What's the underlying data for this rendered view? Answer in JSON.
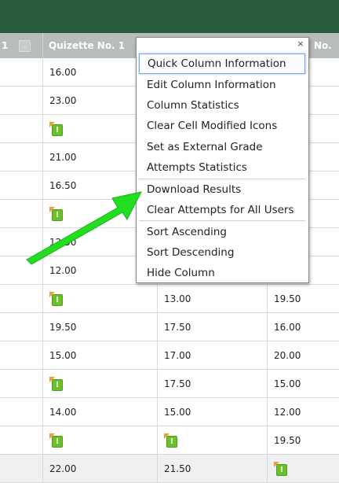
{
  "header": {
    "col0_label": "1",
    "col1_label": "Quizette No. 1",
    "col3_label": "No."
  },
  "rows": [
    {
      "c1": "16.00",
      "c2": "",
      "c3": ""
    },
    {
      "c1": "23.00",
      "c2": "",
      "c3": ""
    },
    {
      "c1": "",
      "c2": "",
      "c3": ""
    },
    {
      "c1": "21.00",
      "c2": "",
      "c3": ""
    },
    {
      "c1": "16.50",
      "c2": "",
      "c3": ""
    },
    {
      "c1": "",
      "c2": "",
      "c3": ""
    },
    {
      "c1": "12.50",
      "c2": "",
      "c3": ""
    },
    {
      "c1": "12.00",
      "c2": "",
      "c3": ""
    },
    {
      "c1": "",
      "c2": "13.00",
      "c3": "19.50"
    },
    {
      "c1": "19.50",
      "c2": "17.50",
      "c3": "16.00"
    },
    {
      "c1": "15.00",
      "c2": "17.00",
      "c3": "20.00"
    },
    {
      "c1": "",
      "c2": "17.50",
      "c3": "15.00"
    },
    {
      "c1": "14.00",
      "c2": "15.00",
      "c3": "12.00"
    },
    {
      "c1": "",
      "c2": "",
      "c3": "19.50"
    },
    {
      "c1": "22.00",
      "c2": "21.50",
      "c3": ""
    }
  ],
  "modified_icon_glyph": "!",
  "context_menu": {
    "close_glyph": "×",
    "items": [
      "Quick Column Information",
      "Edit Column Information",
      "Column Statistics",
      "Clear Cell Modified Icons",
      "Set as External Grade",
      "Attempts Statistics",
      "Download Results",
      "Clear Attempts for All Users",
      "Sort Ascending",
      "Sort Descending",
      "Hide Column"
    ],
    "active_item": "Quick Column Information"
  },
  "colors": {
    "header_bar": "#285c3c",
    "column_header": "#b8bcbd",
    "arrow": "#22dd22",
    "modified_icon": "#6cc12a"
  }
}
